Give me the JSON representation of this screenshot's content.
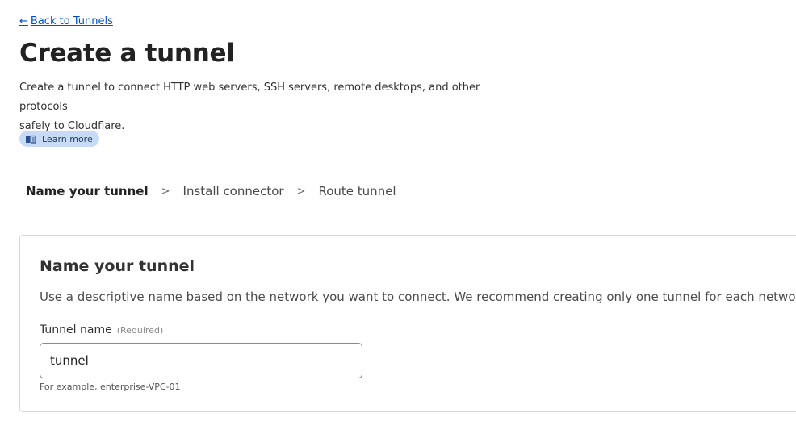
{
  "nav": {
    "back_arrow": "←",
    "back_label": "Back to Tunnels"
  },
  "header": {
    "title": "Create a tunnel",
    "description_line1": "Create a tunnel to connect HTTP web servers, SSH servers, remote desktops, and other protocols",
    "description_line2": "safely to Cloudflare.",
    "learn_more_label": "Learn more",
    "learn_more_icon": "book-icon"
  },
  "steps": [
    {
      "label": "Name your tunnel",
      "active": true
    },
    {
      "label": "Install connector",
      "active": false
    },
    {
      "label": "Route tunnel",
      "active": false
    }
  ],
  "step_separator": ">",
  "card": {
    "title": "Name your tunnel",
    "description": "Use a descriptive name based on the network you want to connect. We recommend creating only one tunnel for each network.",
    "field_label": "Tunnel name",
    "field_required": "(Required)",
    "field_value": "tunnel",
    "field_help": "For example, enterprise-VPC-01"
  },
  "colors": {
    "link": "#0051c3",
    "pill_bg": "#c7dbf7"
  }
}
